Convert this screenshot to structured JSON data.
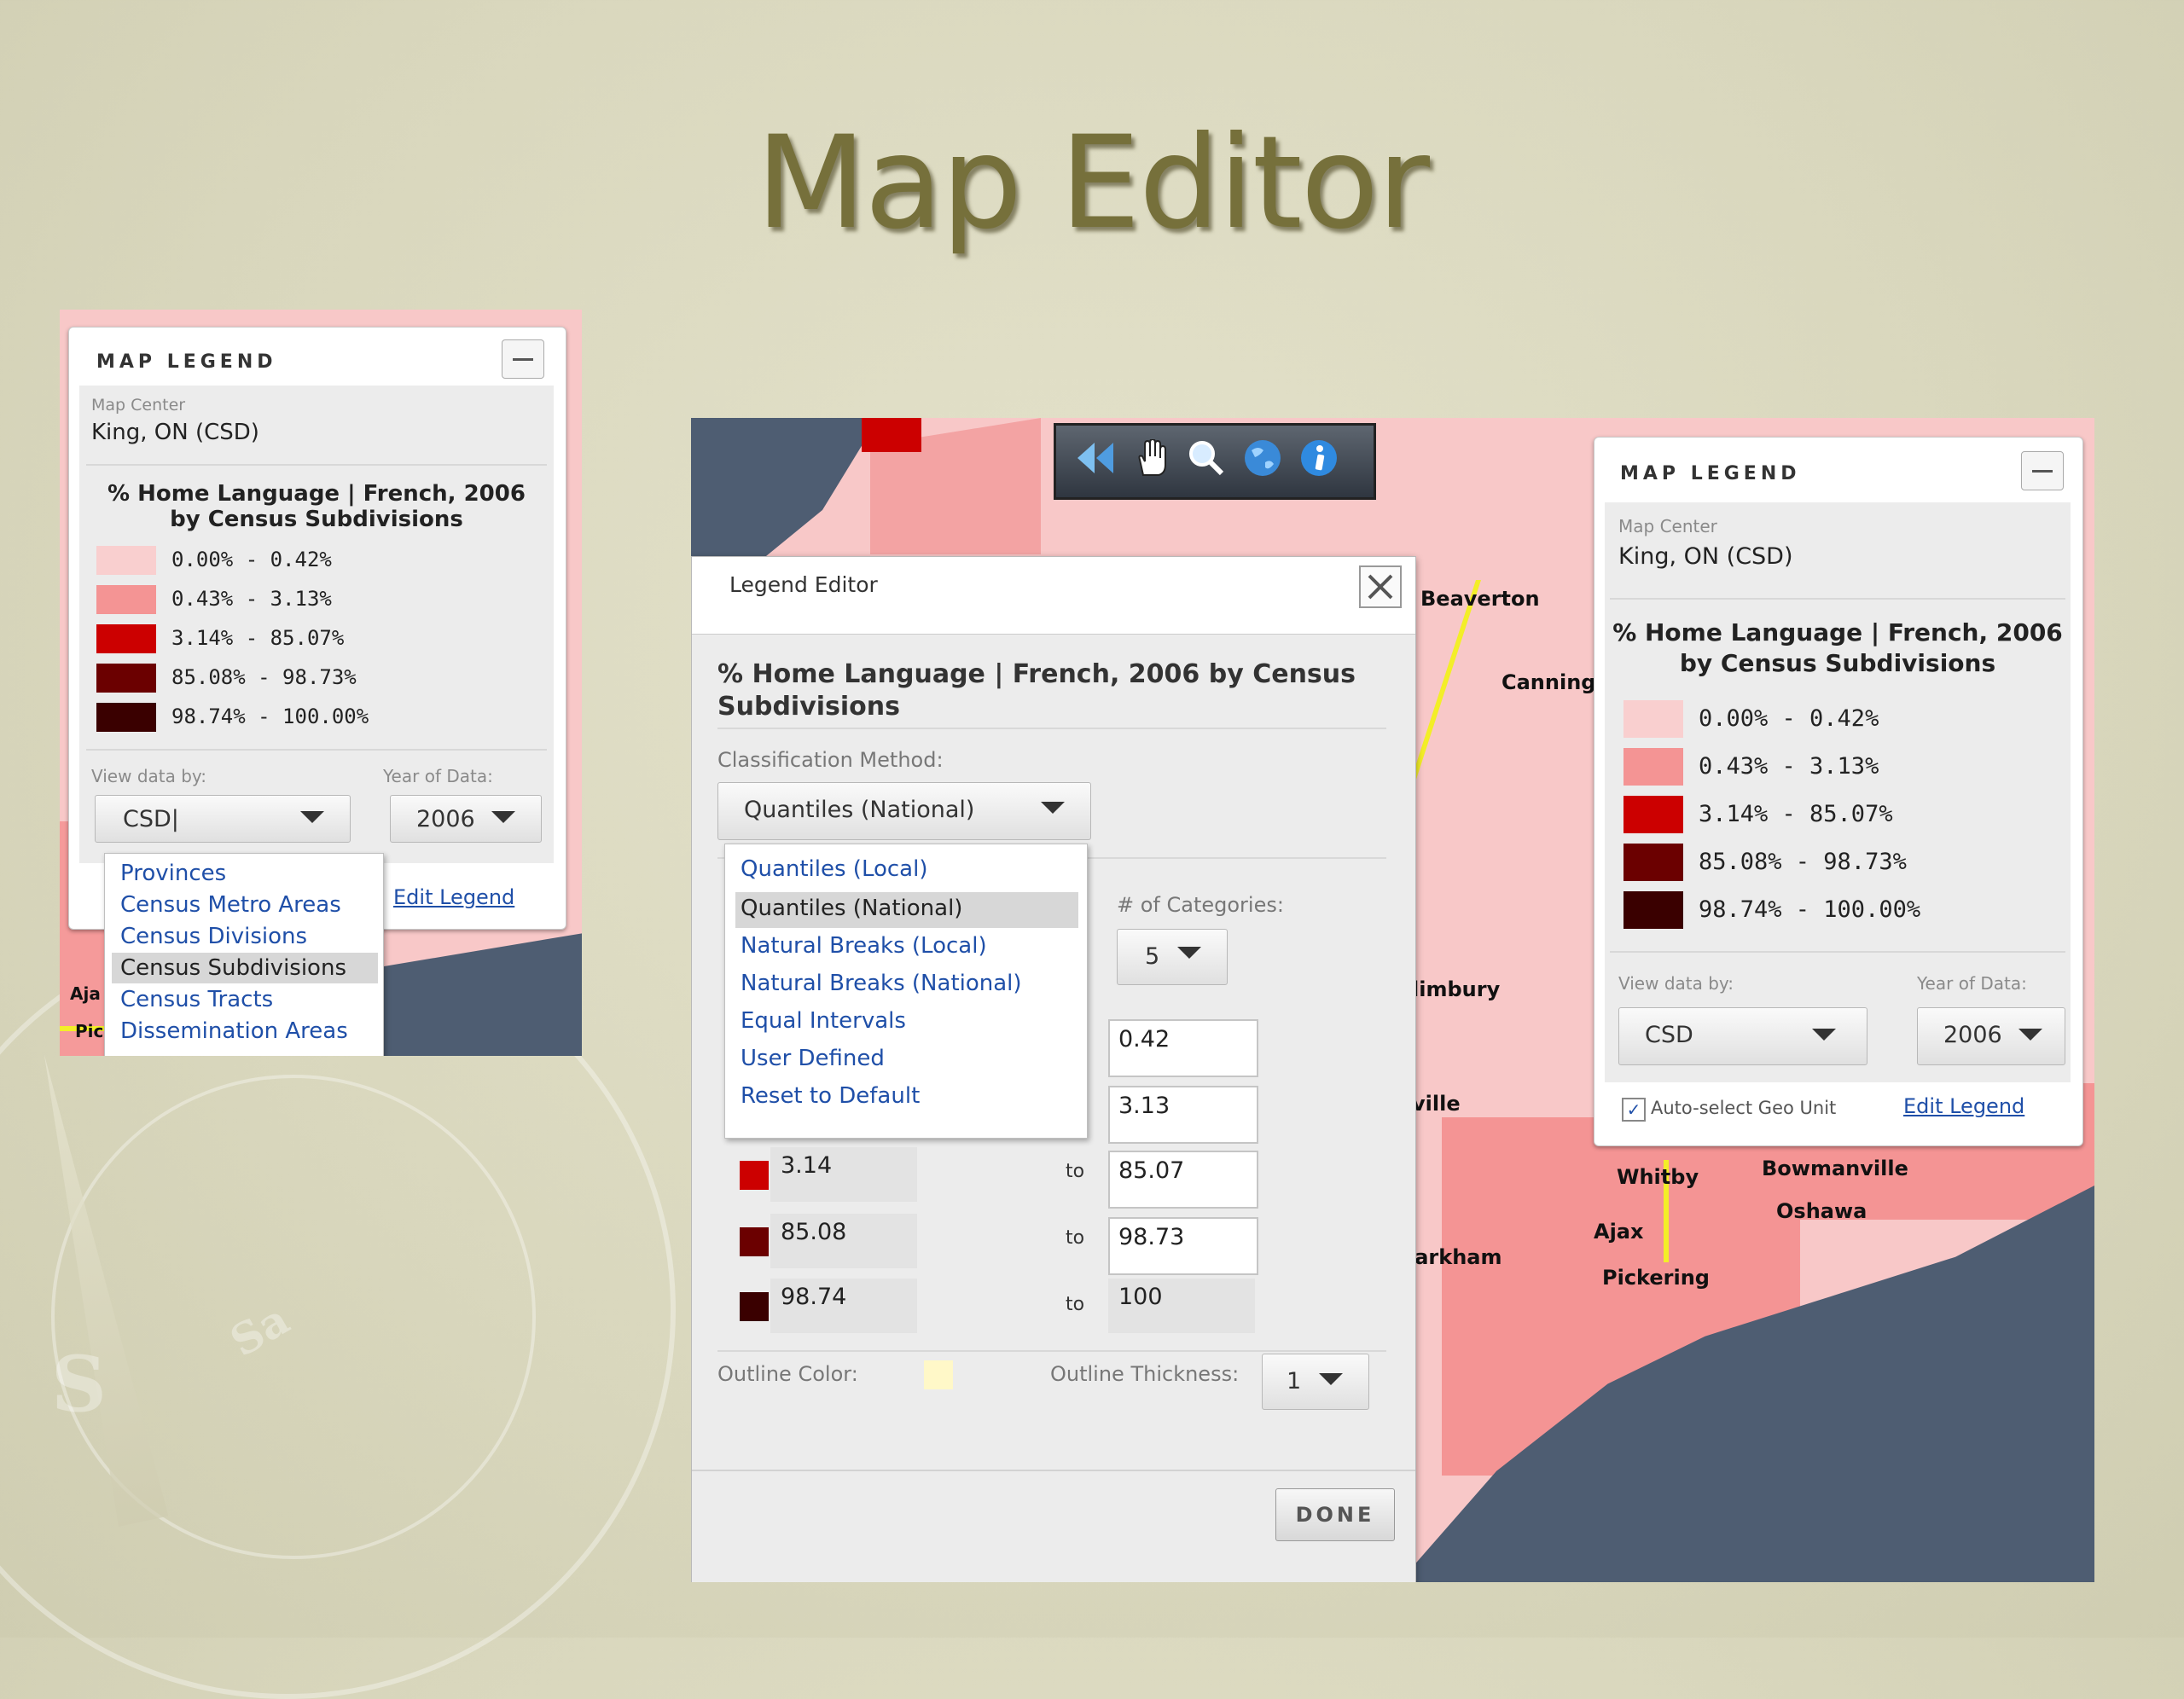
{
  "slide": {
    "title": "Map Editor"
  },
  "compass": {
    "s": "S",
    "sa": "Sa"
  },
  "toolbar": {
    "icons": [
      "rewind-icon",
      "hand-pan-icon",
      "zoom-icon",
      "globe-icon",
      "info-icon"
    ]
  },
  "legend_left": {
    "header": "MAP LEGEND",
    "map_center_label": "Map Center",
    "map_center_value": "King, ON (CSD)",
    "title_line1": "% Home Language | French, 2006",
    "title_line2": "by Census Subdivisions",
    "ranges": [
      "0.00% - 0.42%",
      "0.43% - 3.13%",
      "3.14% - 85.07%",
      "85.08% - 98.73%",
      "98.74% - 100.00%"
    ],
    "view_label": "View data by:",
    "year_label": "Year of Data:",
    "view_value": "CSD|",
    "year_value": "2006",
    "edit_legend": "Edit Legend",
    "dropdown_options": [
      "Provinces",
      "Census Metro Areas",
      "Census Divisions",
      "Census Subdivisions",
      "Census Tracts",
      "Dissemination Areas"
    ],
    "dropdown_selected": "Census Subdivisions",
    "map_places": [
      "Aja",
      "Pic"
    ]
  },
  "legend_right": {
    "header": "MAP LEGEND",
    "map_center_label": "Map Center",
    "map_center_value": "King, ON (CSD)",
    "title_line1": "% Home Language | French, 2006",
    "title_line2": "by Census Subdivisions",
    "ranges": [
      "0.00% - 0.42%",
      "0.43% - 3.13%",
      "3.14% - 85.07%",
      "85.08% - 98.73%",
      "98.74% - 100.00%"
    ],
    "view_label": "View data by:",
    "year_label": "Year of Data:",
    "view_value": "CSD",
    "year_value": "2006",
    "autoselect_label": "Auto-select Geo Unit",
    "autoselect_checked": true,
    "edit_legend": "Edit Legend"
  },
  "map_places": [
    "Beaverton",
    "Canningt",
    "limbury",
    "ville",
    "Whitby",
    "Bowmanville",
    "Oshawa",
    "Ajax",
    "Pickering",
    "larkham"
  ],
  "legend_editor": {
    "title": "Legend Editor",
    "heading_line1": "% Home Language | French, 2006 by Census",
    "heading_line2": "Subdivisions",
    "classification_label": "Classification Method:",
    "classification_value": "Quantiles (National)",
    "method_options": [
      "Quantiles (Local)",
      "Quantiles (National)",
      "Natural Breaks (Local)",
      "Natural Breaks (National)",
      "Equal Intervals",
      "User Defined",
      "Reset to Default"
    ],
    "method_selected": "Quantiles (National)",
    "categories_label": "# of Categories:",
    "categories_value": "5",
    "rows": [
      {
        "from": "",
        "to": "0.42",
        "color": "#f9cfcf"
      },
      {
        "from": "",
        "to": "3.13",
        "color": "#f49494"
      },
      {
        "from": "3.14",
        "to": "85.07",
        "color": "#cc0000"
      },
      {
        "from": "85.08",
        "to": "98.73",
        "color": "#6b0000"
      },
      {
        "from": "98.74",
        "to": "100",
        "color": "#3a0000"
      }
    ],
    "to_word": "to",
    "outline_color_label": "Outline Color:",
    "outline_color": "#fff8c8",
    "outline_thickness_label": "Outline Thickness:",
    "outline_thickness_value": "1",
    "done_label": "DONE"
  },
  "colors": {
    "class1": "#f9cfcf",
    "class2": "#f49494",
    "class3": "#cc0000",
    "class4": "#6b0000",
    "class5": "#3a0000",
    "water": "#4e5d72",
    "boundary": "#f3ee28",
    "title": "#76703b"
  }
}
